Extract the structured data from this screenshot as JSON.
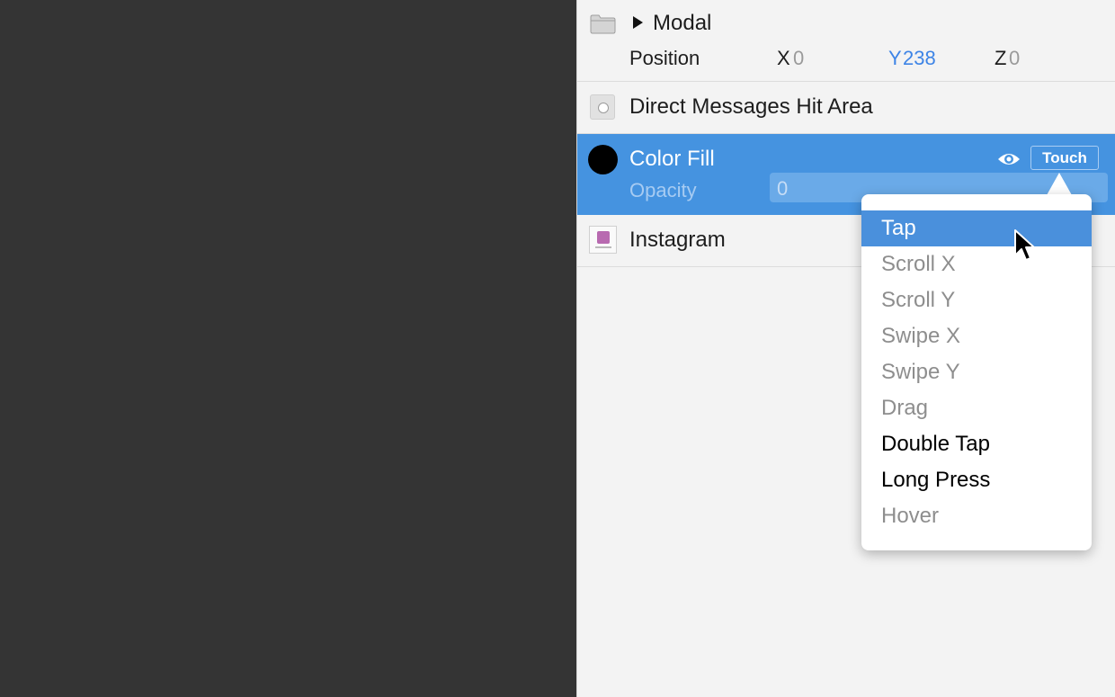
{
  "layers": {
    "modal": {
      "name": "Modal",
      "position_label": "Position",
      "x_label": "X",
      "x_value": "0",
      "y_label": "Y",
      "y_value": "238",
      "z_label": "Z",
      "z_value": "0"
    },
    "hit_area": {
      "name": "Direct Messages Hit Area"
    },
    "color_fill": {
      "name": "Color Fill",
      "opacity_label": "Opacity",
      "opacity_value": "0",
      "touch_label": "Touch",
      "fill_color": "#000000"
    },
    "instagram": {
      "name": "Instagram"
    }
  },
  "touch_menu": {
    "items": [
      {
        "label": "Tap",
        "state": "selected"
      },
      {
        "label": "Scroll X",
        "state": "disabled"
      },
      {
        "label": "Scroll Y",
        "state": "disabled"
      },
      {
        "label": "Swipe X",
        "state": "disabled"
      },
      {
        "label": "Swipe Y",
        "state": "disabled"
      },
      {
        "label": "Drag",
        "state": "disabled"
      },
      {
        "label": "Double Tap",
        "state": "enabled"
      },
      {
        "label": "Long Press",
        "state": "enabled"
      },
      {
        "label": "Hover",
        "state": "disabled"
      }
    ]
  },
  "colors": {
    "selection": "#4593e0",
    "accent": "#3d84e6",
    "menu_highlight": "#4a90dc",
    "canvas": "#343434"
  },
  "icons": [
    "folder-icon",
    "disclosure-triangle-icon",
    "hit-area-icon",
    "color-fill-icon",
    "eye-icon",
    "instagram-thumbnail-icon",
    "cursor-icon"
  ]
}
